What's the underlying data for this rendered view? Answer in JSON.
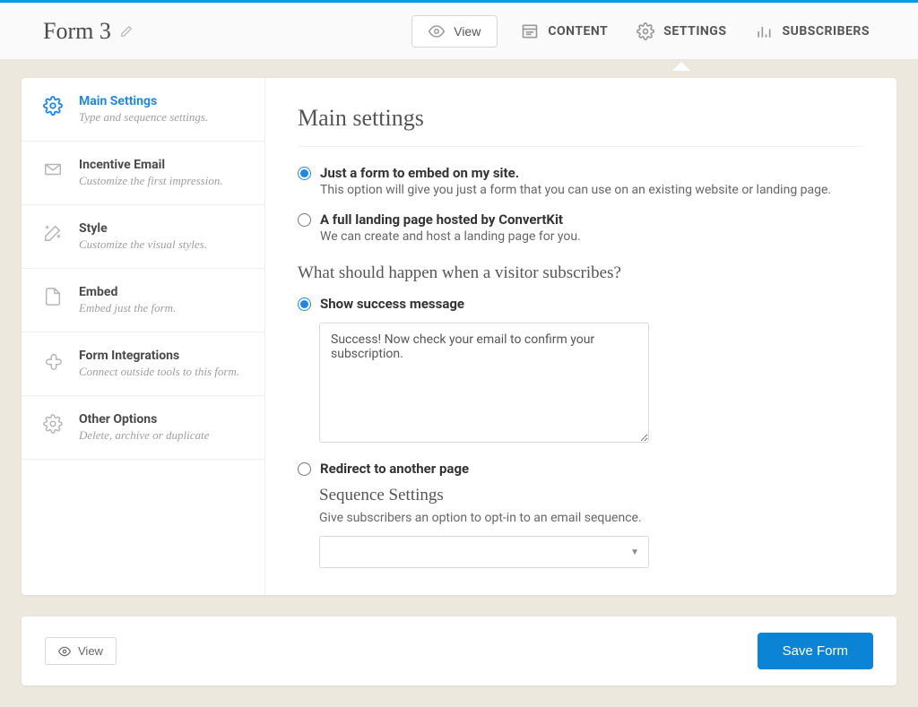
{
  "header": {
    "title": "Form 3",
    "view_label": "View",
    "nav": {
      "content": "CONTENT",
      "settings": "SETTINGS",
      "subscribers": "SUBSCRIBERS"
    }
  },
  "sidebar": {
    "items": [
      {
        "title": "Main Settings",
        "sub": "Type and sequence settings."
      },
      {
        "title": "Incentive Email",
        "sub": "Customize the first impression."
      },
      {
        "title": "Style",
        "sub": "Customize the visual styles."
      },
      {
        "title": "Embed",
        "sub": "Embed just the form."
      },
      {
        "title": "Form Integrations",
        "sub": "Connect outside tools to this form."
      },
      {
        "title": "Other Options",
        "sub": "Delete, archive or duplicate"
      }
    ]
  },
  "main": {
    "heading": "Main settings",
    "radio_embed_label": "Just a form to embed on my site.",
    "radio_embed_desc": "This option will give you just a form that you can use on an existing website or landing page.",
    "radio_landing_label": "A full landing page hosted by ConvertKit",
    "radio_landing_desc": "We can create and host a landing page for you.",
    "sub_question": "What should happen when a visitor subscribes?",
    "radio_success_label": "Show success message",
    "success_text": "Success! Now check your email to confirm your subscription.",
    "radio_redirect_label": "Redirect to another page",
    "seq_heading": "Sequence Settings",
    "seq_desc": "Give subscribers an option to opt-in to an email sequence."
  },
  "footer": {
    "view_label": "View",
    "save_label": "Save Form"
  }
}
